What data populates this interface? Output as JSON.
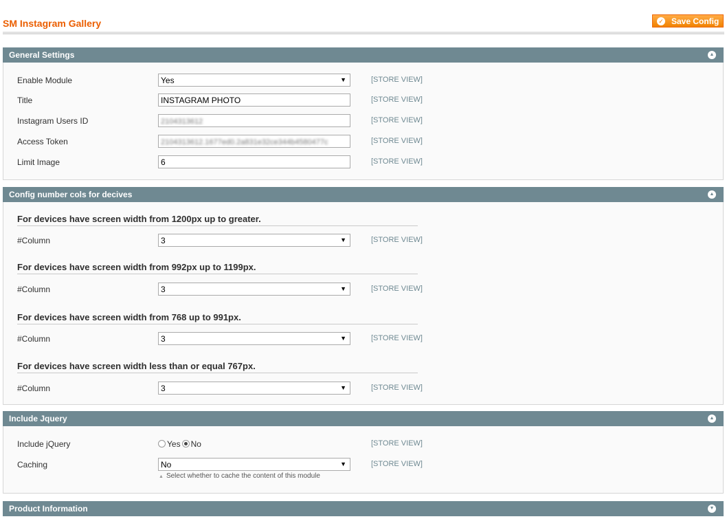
{
  "page": {
    "title": "SM Instagram Gallery",
    "save_button": "Save Config",
    "save_icon": "check-circle-icon"
  },
  "general": {
    "title": "General Settings",
    "toggle_icon": "collapse-up-icon",
    "fields": [
      {
        "label": "Enable Module",
        "value": "Yes",
        "type": "select",
        "scope": "[STORE VIEW]"
      },
      {
        "label": "Title",
        "value": "INSTAGRAM PHOTO",
        "type": "text",
        "scope": "[STORE VIEW]"
      },
      {
        "label": "Instagram Users ID",
        "value": "2104313612",
        "type": "text",
        "scope": "[STORE VIEW]"
      },
      {
        "label": "Access Token",
        "value": "2104313612.1677ed0.2a831e32ce344b4580477c",
        "type": "text",
        "scope": "[STORE VIEW]"
      },
      {
        "label": "Limit Image",
        "value": "6",
        "type": "text",
        "scope": "[STORE VIEW]"
      }
    ]
  },
  "cols": {
    "title": "Config number cols for decives",
    "groups": [
      {
        "heading": "For devices have screen width from 1200px up to greater.",
        "label": "#Column",
        "value": "3",
        "scope": "[STORE VIEW]"
      },
      {
        "heading": "For devices have screen width from 992px up to 1199px.",
        "label": "#Column",
        "value": "3",
        "scope": "[STORE VIEW]"
      },
      {
        "heading": "For devices have screen width from 768 up to 991px.",
        "label": "#Column",
        "value": "3",
        "scope": "[STORE VIEW]"
      },
      {
        "heading": "For devices have screen width less than or equal 767px.",
        "label": "#Column",
        "value": "3",
        "scope": "[STORE VIEW]"
      }
    ]
  },
  "jquery": {
    "title": "Include Jquery",
    "include_label": "Include jQuery",
    "include_options": [
      "Yes",
      "No"
    ],
    "include_selected": "No",
    "include_scope": "[STORE VIEW]",
    "caching_label": "Caching",
    "caching_value": "No",
    "caching_scope": "[STORE VIEW]",
    "caching_note": "Select whether to cache the content of this module"
  },
  "product": {
    "title": "Product Information",
    "toggle_icon": "expand-down-icon"
  }
}
